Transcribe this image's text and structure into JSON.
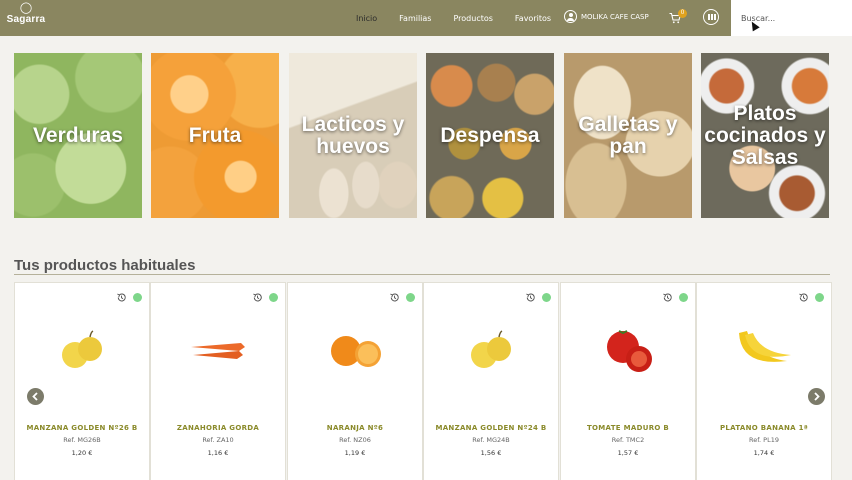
{
  "header": {
    "brand": "Sagarra",
    "nav": [
      "Inicio",
      "Familias",
      "Productos",
      "Favoritos"
    ],
    "user": "MOLIKA CAFE CASP",
    "cart_count": "0",
    "search_placeholder": "Buscar..."
  },
  "categories": [
    {
      "label": "Verduras"
    },
    {
      "label": "Fruta"
    },
    {
      "label": "Lacticos y huevos"
    },
    {
      "label": "Despensa"
    },
    {
      "label": "Galletas y pan"
    },
    {
      "label": "Platos cocinados y Salsas"
    }
  ],
  "section": {
    "title": "Tus productos habituales"
  },
  "products": [
    {
      "name": "MANZANA GOLDEN Nº26 B",
      "ref": "Ref. MG26B",
      "price": "1,20 €",
      "icon": "apple-icon"
    },
    {
      "name": "ZANAHORIA GORDA",
      "ref": "Ref. ZA10",
      "price": "1,16 €",
      "icon": "carrot-icon"
    },
    {
      "name": "NARANJA Nº6",
      "ref": "Ref. NZ06",
      "price": "1,19 €",
      "icon": "orange-icon"
    },
    {
      "name": "MANZANA GOLDEN Nº24 B",
      "ref": "Ref. MG24B",
      "price": "1,56 €",
      "icon": "apple-icon"
    },
    {
      "name": "TOMATE MADURO B",
      "ref": "Ref. TMC2",
      "price": "1,57 €",
      "icon": "tomato-icon"
    },
    {
      "name": "PLATANO BANANA 1ª",
      "ref": "Ref. PL19",
      "price": "1,74 €",
      "icon": "banana-icon"
    }
  ],
  "colors": {
    "header": "#8a8660",
    "status": "#7ed68a",
    "product_name": "#8a8a2a"
  }
}
